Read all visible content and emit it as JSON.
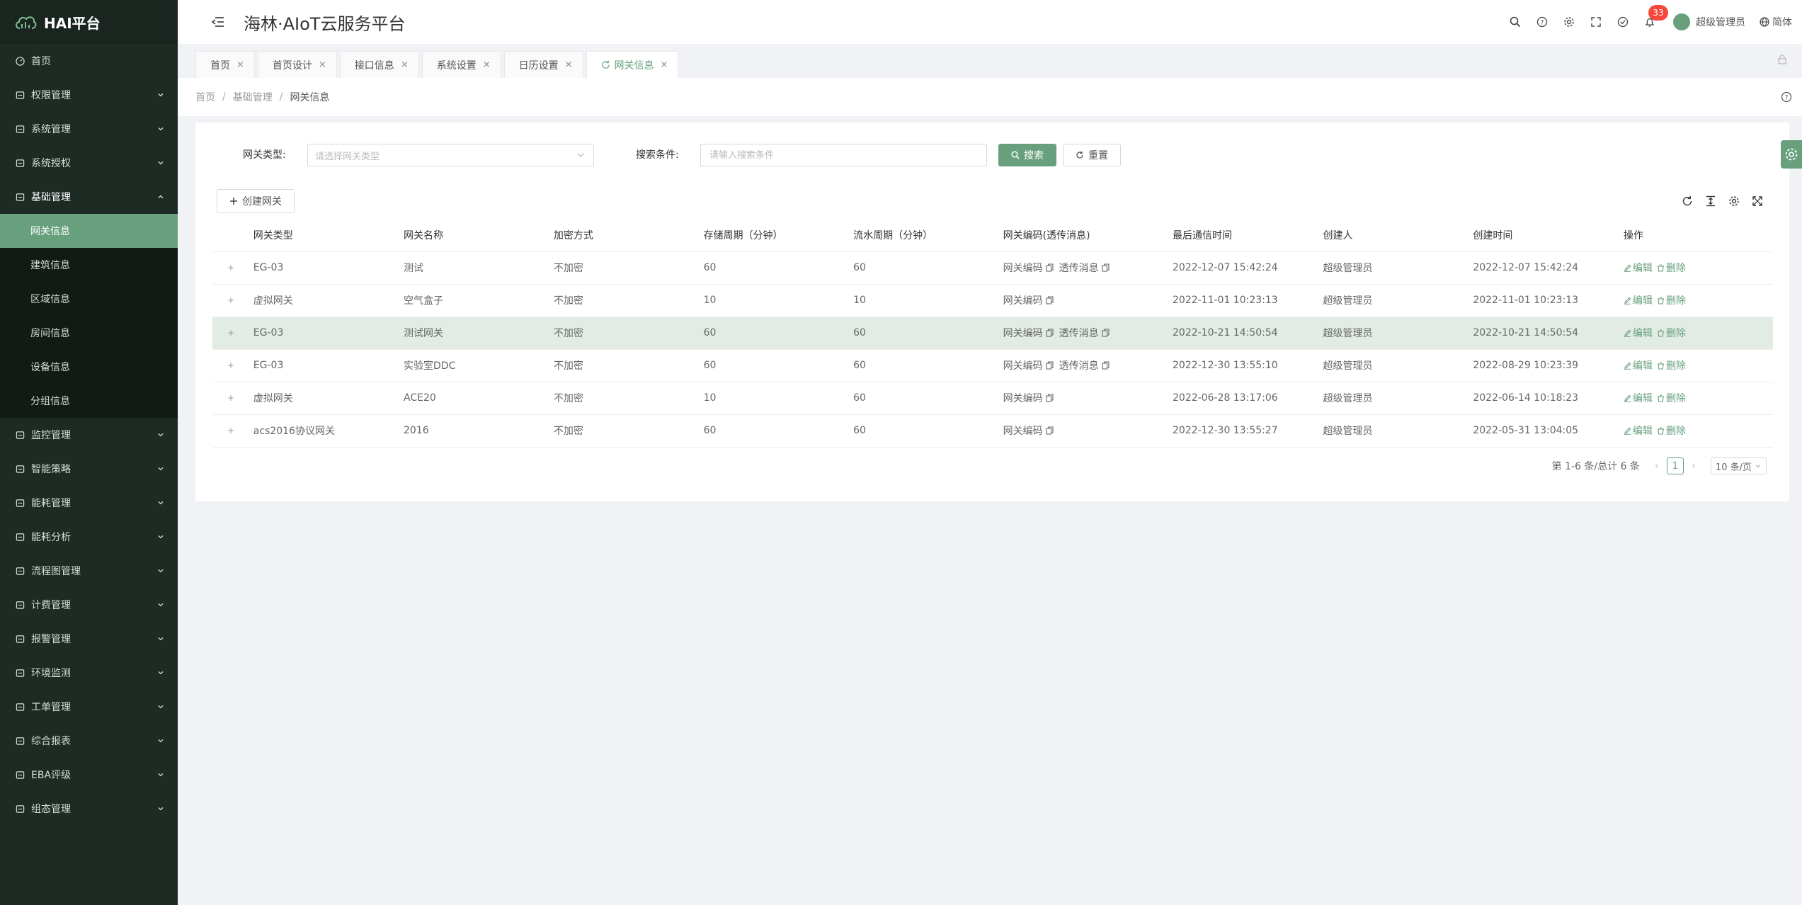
{
  "brand": {
    "name": "HAI平台",
    "accent": "#68a07e"
  },
  "header": {
    "title": "海林·AIoT云服务平台",
    "notifications": "33",
    "user": "超级管理员",
    "language": "简体"
  },
  "sidebar": {
    "items": [
      {
        "label": "首页",
        "icon": "dashboard-icon"
      },
      {
        "label": "权限管理",
        "icon": "shield-icon"
      },
      {
        "label": "系统管理",
        "icon": "monitor-icon"
      },
      {
        "label": "系统授权",
        "icon": "document-icon"
      },
      {
        "label": "基础管理",
        "icon": "database-icon"
      },
      {
        "label": "监控管理",
        "icon": "monitor-icon"
      },
      {
        "label": "智能策略",
        "icon": "bulb-icon"
      },
      {
        "label": "能耗管理",
        "icon": "sliders-icon"
      },
      {
        "label": "能耗分析",
        "icon": "bar-chart-icon"
      },
      {
        "label": "流程图管理",
        "icon": "flow-icon"
      },
      {
        "label": "计费管理",
        "icon": "wallet-icon"
      },
      {
        "label": "报警管理",
        "icon": "alarm-icon"
      },
      {
        "label": "环境监测",
        "icon": "leaf-icon"
      },
      {
        "label": "工单管理",
        "icon": "layers-icon"
      },
      {
        "label": "综合报表",
        "icon": "report-icon"
      },
      {
        "label": "EBA评级",
        "icon": "rating-icon"
      },
      {
        "label": "组态管理",
        "icon": "config-icon"
      }
    ],
    "submenu": [
      "网关信息",
      "建筑信息",
      "区域信息",
      "房间信息",
      "设备信息",
      "分组信息"
    ]
  },
  "tabs": [
    "首页",
    "首页设计",
    "接口信息",
    "系统设置",
    "日历设置",
    "网关信息"
  ],
  "breadcrumb": [
    "首页",
    "基础管理",
    "网关信息"
  ],
  "search": {
    "type_label": "网关类型:",
    "type_placeholder": "请选择网关类型",
    "cond_label": "搜索条件:",
    "cond_placeholder": "请输入搜索条件",
    "search_btn": "搜索",
    "reset_btn": "重置"
  },
  "toolbar": {
    "create_btn": "创建网关"
  },
  "table": {
    "columns": [
      "网关类型",
      "网关名称",
      "加密方式",
      "存储周期（分钟）",
      "流水周期（分钟）",
      "网关编码(透传消息)",
      "最后通信时间",
      "创建人",
      "创建时间",
      "操作"
    ],
    "rows": [
      {
        "type": "EG-03",
        "name": "测试",
        "enc": "不加密",
        "store": "60",
        "flow": "60",
        "code": "网关编码",
        "msg": "透传消息",
        "last": "2022-12-07 15:42:24",
        "creator": "超级管理员",
        "created": "2022-12-07 15:42:24"
      },
      {
        "type": "虚拟网关",
        "name": "空气盒子",
        "enc": "不加密",
        "store": "10",
        "flow": "10",
        "code": "网关编码",
        "msg": "",
        "last": "2022-11-01 10:23:13",
        "creator": "超级管理员",
        "created": "2022-11-01 10:23:13"
      },
      {
        "type": "EG-03",
        "name": "测试网关",
        "enc": "不加密",
        "store": "60",
        "flow": "60",
        "code": "网关编码",
        "msg": "透传消息",
        "last": "2022-10-21 14:50:54",
        "creator": "超级管理员",
        "created": "2022-10-21 14:50:54"
      },
      {
        "type": "EG-03",
        "name": "实验室DDC",
        "enc": "不加密",
        "store": "60",
        "flow": "60",
        "code": "网关编码",
        "msg": "透传消息",
        "last": "2022-12-30 13:55:10",
        "creator": "超级管理员",
        "created": "2022-08-29 10:23:39"
      },
      {
        "type": "虚拟网关",
        "name": "ACE20",
        "enc": "不加密",
        "store": "10",
        "flow": "60",
        "code": "网关编码",
        "msg": "",
        "last": "2022-06-28 13:17:06",
        "creator": "超级管理员",
        "created": "2022-06-14 10:18:23"
      },
      {
        "type": "acs2016协议网关",
        "name": "2016",
        "enc": "不加密",
        "store": "60",
        "flow": "60",
        "code": "网关编码",
        "msg": "",
        "last": "2022-12-30 13:55:27",
        "creator": "超级管理员",
        "created": "2022-05-31 13:04:05"
      }
    ],
    "edit": "编辑",
    "delete": "删除",
    "expand": "+"
  },
  "pagination": {
    "summary": "第 1-6 条/总计 6 条",
    "page": "1",
    "size": "10 条/页"
  }
}
